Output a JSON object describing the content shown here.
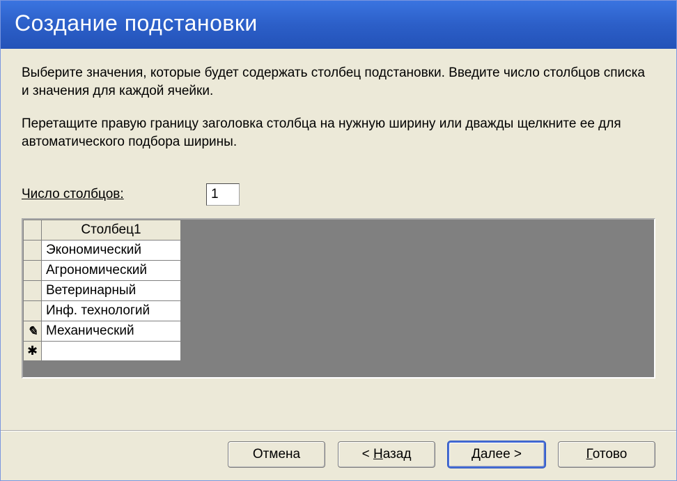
{
  "window": {
    "title": "Создание подстановки"
  },
  "instructions": {
    "p1": "Выберите значения, которые будет содержать столбец подстановки. Введите число столбцов списка и значения для каждой ячейки.",
    "p2": "Перетащите правую границу заголовка столбца на нужную ширину или дважды щелкните ее для автоматического подбора ширины."
  },
  "columns": {
    "label": "Число столбцов:",
    "value": "1"
  },
  "grid": {
    "header": "Столбец1",
    "rows": [
      {
        "selector": "",
        "value": "Экономический"
      },
      {
        "selector": "",
        "value": "Агрономический"
      },
      {
        "selector": "",
        "value": "Ветеринарный"
      },
      {
        "selector": "",
        "value": "Инф. технологий"
      },
      {
        "selector": "pencil",
        "value": "Механический"
      },
      {
        "selector": "star",
        "value": ""
      }
    ],
    "icons": {
      "pencil": "✎",
      "star": "✱"
    }
  },
  "buttons": {
    "cancel": "Отмена",
    "back_pre": "< ",
    "back_hk": "Н",
    "back_post": "азад",
    "next_hk": "Д",
    "next_post": "алее >",
    "finish_hk": "Г",
    "finish_post": "отово"
  }
}
